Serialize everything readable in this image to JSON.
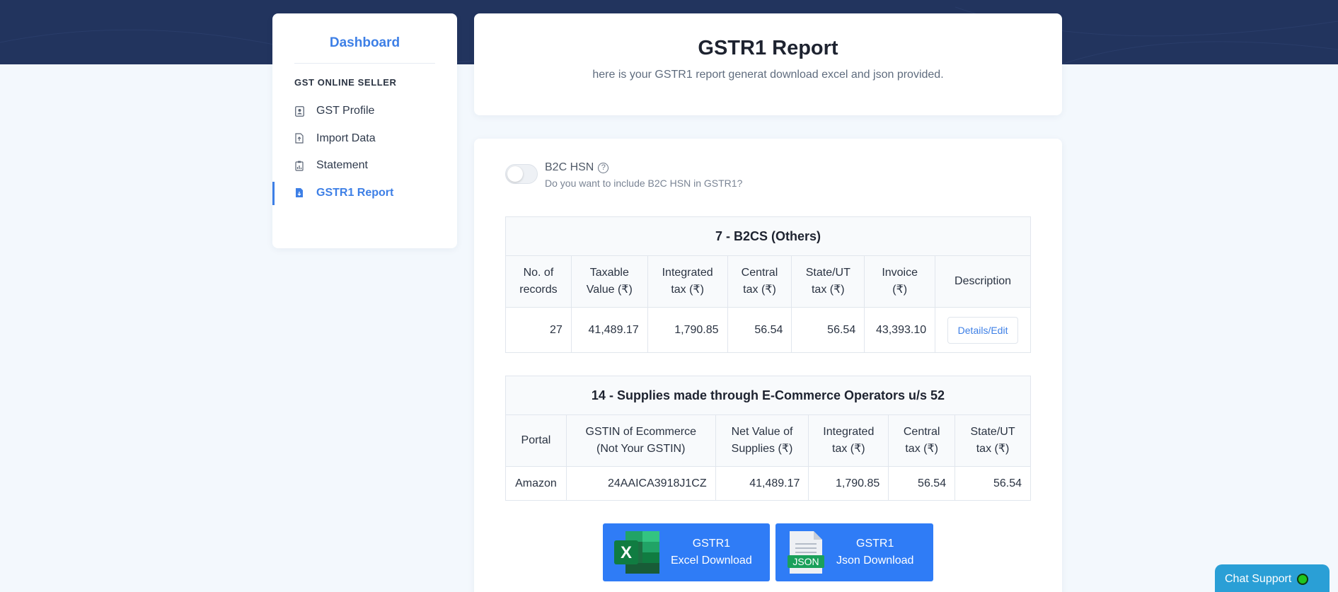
{
  "sidebar": {
    "brand": "Dashboard",
    "section": "GST ONLINE SELLER",
    "items": [
      {
        "label": "GST Profile",
        "icon": "profile-icon"
      },
      {
        "label": "Import Data",
        "icon": "file-import-icon"
      },
      {
        "label": "Statement",
        "icon": "statement-icon"
      },
      {
        "label": "GSTR1 Report",
        "icon": "report-file-icon",
        "active": true
      }
    ]
  },
  "header": {
    "title": "GSTR1 Report",
    "subtitle": "here is your GSTR1 report generat download excel and json provided."
  },
  "toggle": {
    "title": "B2C HSN",
    "help": "?",
    "subtitle": "Do you want to include B2C HSN in GSTR1?"
  },
  "b2cs": {
    "caption": "7 - B2CS (Others)",
    "headers": [
      [
        "No. of",
        "records"
      ],
      [
        "Taxable",
        "Value (₹)"
      ],
      [
        "Integrated",
        "tax (₹)"
      ],
      [
        "Central",
        "tax (₹)"
      ],
      [
        "State/UT",
        "tax (₹)"
      ],
      [
        "Invoice",
        "(₹)"
      ],
      [
        "Description",
        ""
      ]
    ],
    "row": [
      "27",
      "41,489.17",
      "1,790.85",
      "56.54",
      "56.54",
      "43,393.10"
    ],
    "action": "Details/Edit"
  },
  "ecom": {
    "caption": "14 - Supplies made through E-Commerce Operators u/s 52",
    "headers": [
      [
        "Portal",
        ""
      ],
      [
        "GSTIN of Ecommerce",
        "(Not Your GSTIN)"
      ],
      [
        "Net Value of",
        "Supplies (₹)"
      ],
      [
        "Integrated",
        "tax (₹)"
      ],
      [
        "Central",
        "tax (₹)"
      ],
      [
        "State/UT",
        "tax (₹)"
      ]
    ],
    "row": [
      "Amazon",
      "24AAICA3918J1CZ",
      "41,489.17",
      "1,790.85",
      "56.54",
      "56.54"
    ]
  },
  "downloads": {
    "excel": {
      "line1": "GSTR1",
      "line2": "Excel Download",
      "icon_letter": "X"
    },
    "json": {
      "line1": "GSTR1",
      "line2": "Json Download",
      "icon_label": "JSON"
    }
  },
  "chat": {
    "label": "Chat Support"
  },
  "colors": {
    "accent": "#3d7fe6",
    "button": "#2f7cf6",
    "band": "#22345e",
    "chat": "#2a9fd6"
  }
}
